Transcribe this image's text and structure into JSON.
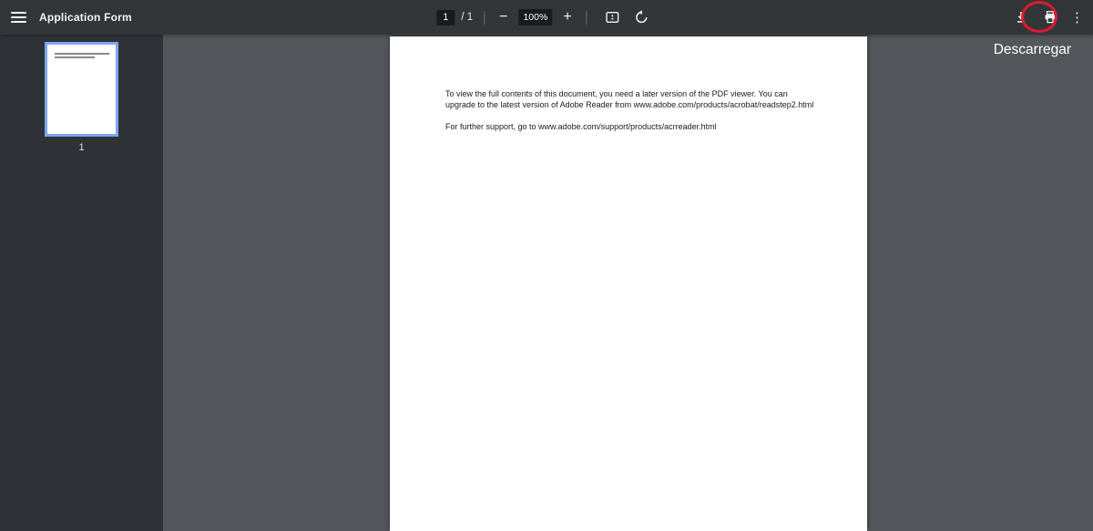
{
  "toolbar": {
    "title": "Application Form",
    "page_input_value": "1",
    "page_total": "/ 1",
    "zoom_value": "100%",
    "icons": {
      "menu": "menu-icon",
      "zoom_out_glyph": "−",
      "zoom_in_glyph": "+",
      "fit_page": "fit-page-icon",
      "rotate": "rotate-counterclockwise-icon",
      "download": "download-icon",
      "print": "print-icon",
      "more_glyph": "⋮"
    }
  },
  "sidebar": {
    "thumbnail_page_number": "1"
  },
  "document": {
    "paragraphs": [
      "To view the full contents of this document, you need a later version of the PDF viewer. You can upgrade to the latest version of Adobe Reader from www.adobe.com/products/acrobat/readstep2.html",
      "For further support, go to www.adobe.com/support/products/acrreader.html"
    ]
  },
  "tooltip": {
    "download_label": "Descarregar"
  },
  "colors": {
    "toolbar_bg": "#323639",
    "sidebar_bg": "#2f3337",
    "content_bg": "#53565a",
    "thumbnail_selected_border": "#7ea6f3",
    "annotation_red": "#de1b2e"
  }
}
